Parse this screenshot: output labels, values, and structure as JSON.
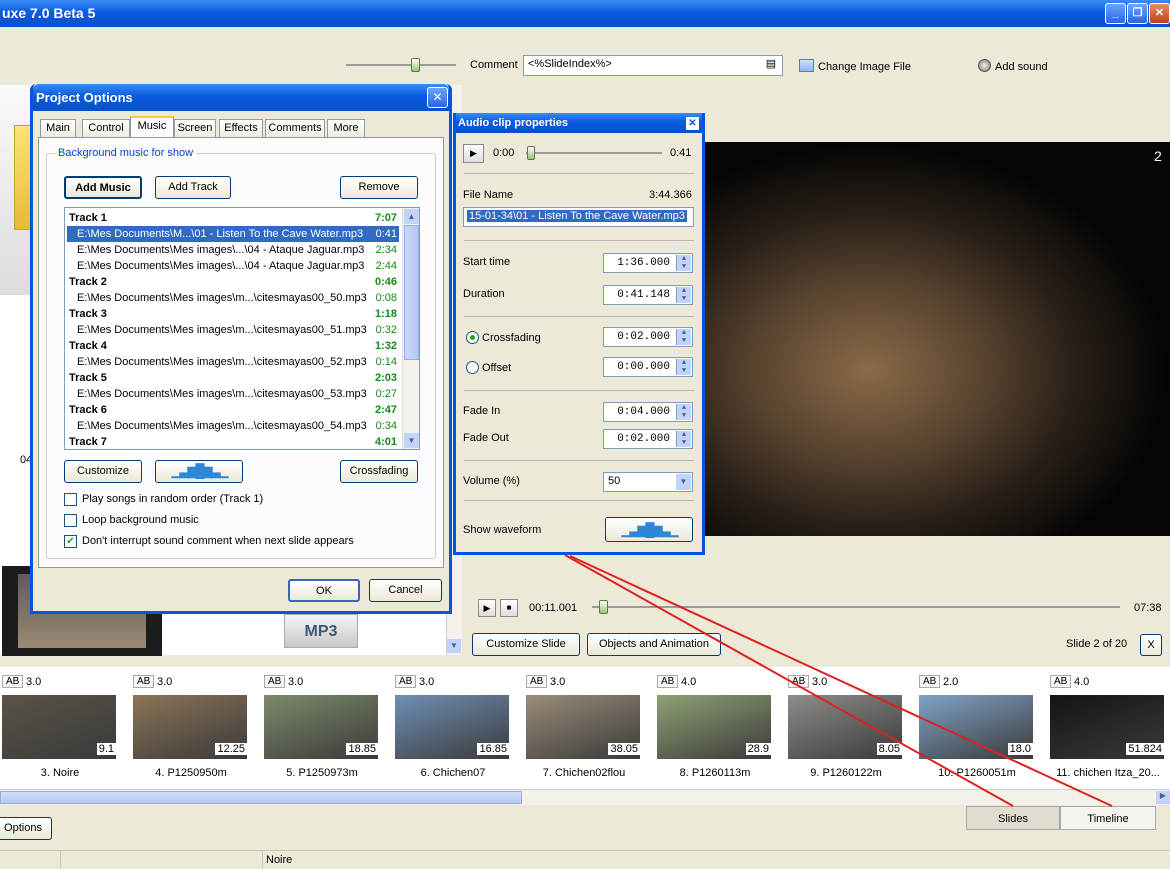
{
  "app": {
    "title": "uxe 7.0 Beta 5"
  },
  "toolbar": {
    "comment_label": "Comment",
    "comment_value": "<%SlideIndex%>",
    "change_image_label": "Change Image File",
    "add_sound_label": "Add sound"
  },
  "preview": {
    "slide_number": "2",
    "time_current": "00:11.001",
    "time_total": "07:38",
    "customize_slide_label": "Customize Slide",
    "objects_animation_label": "Objects and Animation",
    "slide_position": "Slide 2 of 20",
    "close_label": "X"
  },
  "left_panel": {
    "partial_text": "04",
    "mp3_label": "MP3"
  },
  "project_options": {
    "title": "Project Options",
    "tabs": [
      "Main",
      "Control",
      "Music",
      "Screen",
      "Effects",
      "Comments",
      "More"
    ],
    "active_tab": "Music",
    "group_label": "Background music for show",
    "add_music_label": "Add Music",
    "add_track_label": "Add Track",
    "remove_label": "Remove",
    "rows": [
      {
        "kind": "track",
        "text": "Track 1",
        "time": "7:07"
      },
      {
        "kind": "file",
        "text": "E:\\Mes Documents\\M...\\01 - Listen To the Cave Water.mp3",
        "time": "0:41",
        "selected": true
      },
      {
        "kind": "file",
        "text": "E:\\Mes Documents\\Mes images\\...\\04 - Ataque Jaguar.mp3",
        "time": "2:34"
      },
      {
        "kind": "file",
        "text": "E:\\Mes Documents\\Mes images\\...\\04 - Ataque Jaguar.mp3",
        "time": "2:44"
      },
      {
        "kind": "track",
        "text": "Track 2",
        "time": "0:46"
      },
      {
        "kind": "file",
        "text": "E:\\Mes Documents\\Mes images\\m...\\citesmayas00_50.mp3",
        "time": "0:08"
      },
      {
        "kind": "track",
        "text": "Track 3",
        "time": "1:18"
      },
      {
        "kind": "file",
        "text": "E:\\Mes Documents\\Mes images\\m...\\citesmayas00_51.mp3",
        "time": "0:32"
      },
      {
        "kind": "track",
        "text": "Track 4",
        "time": "1:32"
      },
      {
        "kind": "file",
        "text": "E:\\Mes Documents\\Mes images\\m...\\citesmayas00_52.mp3",
        "time": "0:14"
      },
      {
        "kind": "track",
        "text": "Track 5",
        "time": "2:03"
      },
      {
        "kind": "file",
        "text": "E:\\Mes Documents\\Mes images\\m...\\citesmayas00_53.mp3",
        "time": "0:27"
      },
      {
        "kind": "track",
        "text": "Track 6",
        "time": "2:47"
      },
      {
        "kind": "file",
        "text": "E:\\Mes Documents\\Mes images\\m...\\citesmayas00_54.mp3",
        "time": "0:34"
      },
      {
        "kind": "track",
        "text": "Track 7",
        "time": "4:01"
      }
    ],
    "customize_label": "Customize",
    "crossfading_label": "Crossfading",
    "random_label": "Play songs in random order (Track 1)",
    "random_checked": false,
    "loop_label": "Loop background music",
    "loop_checked": false,
    "no_interrupt_label": "Don't interrupt sound comment when next slide appears",
    "no_interrupt_checked": true,
    "ok_label": "OK",
    "cancel_label": "Cancel"
  },
  "audio_clip": {
    "title": "Audio clip properties",
    "time_start": "0:00",
    "time_end": "0:41",
    "file_name_label": "File Name",
    "file_duration": "3:44.366",
    "file_name_value": "15-01-34\\01 - Listen To the Cave Water.mp3",
    "start_time_label": "Start time",
    "start_time_value": "1:36.000",
    "duration_label": "Duration",
    "duration_value": "0:41.148",
    "crossfading_label": "Crossfading",
    "crossfading_value": "0:02.000",
    "offset_label": "Offset",
    "offset_value": "0:00.000",
    "fade_in_label": "Fade In",
    "fade_in_value": "0:04.000",
    "fade_out_label": "Fade Out",
    "fade_out_value": "0:02.000",
    "volume_label": "Volume (%)",
    "volume_value": "50",
    "show_waveform_label": "Show waveform"
  },
  "thumbnails": [
    {
      "mode": "AB",
      "duration": "3.0",
      "length": "9.1",
      "name": "3. Noire",
      "color": "#5a5347"
    },
    {
      "mode": "AB",
      "duration": "3.0",
      "length": "12.25",
      "name": "4. P1250950m",
      "color": "#8c7456"
    },
    {
      "mode": "AB",
      "duration": "3.0",
      "length": "18.85",
      "name": "5. P1250973m",
      "color": "#7d8a6a"
    },
    {
      "mode": "AB",
      "duration": "3.0",
      "length": "16.85",
      "name": "6. Chichen07",
      "color": "#6f8fb5"
    },
    {
      "mode": "AB",
      "duration": "3.0",
      "length": "38.05",
      "name": "7. Chichen02flou",
      "color": "#9a8c78"
    },
    {
      "mode": "AB",
      "duration": "4.0",
      "length": "28.9",
      "name": "8. P1260113m",
      "color": "#8fa173"
    },
    {
      "mode": "AB",
      "duration": "3.0",
      "length": "8.05",
      "name": "9. P1260122m",
      "color": "#8d8c88"
    },
    {
      "mode": "AB",
      "duration": "2.0",
      "length": "18.0",
      "name": "10. P1260051m",
      "color": "#7fa3c8"
    },
    {
      "mode": "AB",
      "duration": "4.0",
      "length": "51.824",
      "name": "11. chichen Itza_20...",
      "color": "#141414"
    }
  ],
  "bottom": {
    "options_label": "Options",
    "slides_tab": "Slides",
    "timeline_tab": "Timeline",
    "status_text": "Noire"
  },
  "colors": {
    "xp_blue": "#0a5be0",
    "track_green": "#178a17",
    "selection": "#316ac5",
    "annotation_red": "#e02020"
  }
}
